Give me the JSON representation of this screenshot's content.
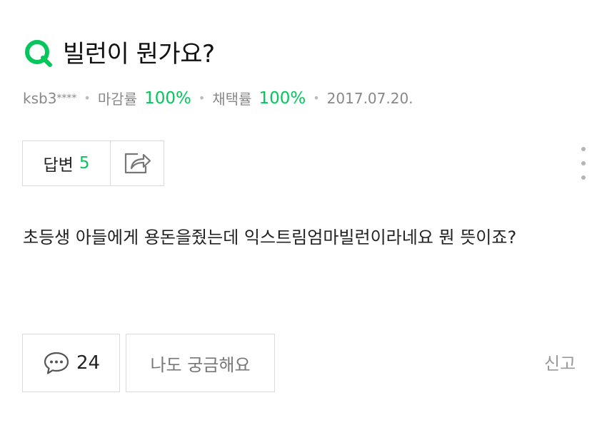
{
  "question": {
    "title": "빌런이 뭔가요?",
    "author": "ksb3",
    "author_mask": "****",
    "deadline_label": "마감률",
    "deadline_rate": "100%",
    "adopt_label": "채택률",
    "adopt_rate": "100%",
    "date": "2017.07.20.",
    "body": "초등생 아들에게 용돈을줬는데 익스트림엄마빌런이라네요 뭔 뜻이죠?"
  },
  "actions": {
    "answer_label": "답변",
    "answer_count": "5",
    "comment_count": "24",
    "curious_label": "나도 궁금해요",
    "report_label": "신고"
  },
  "colors": {
    "accent": "#03c75a",
    "border": "#dadada",
    "muted": "#888888"
  },
  "icons": [
    "q-icon",
    "share-icon",
    "more-icon",
    "comment-icon"
  ]
}
